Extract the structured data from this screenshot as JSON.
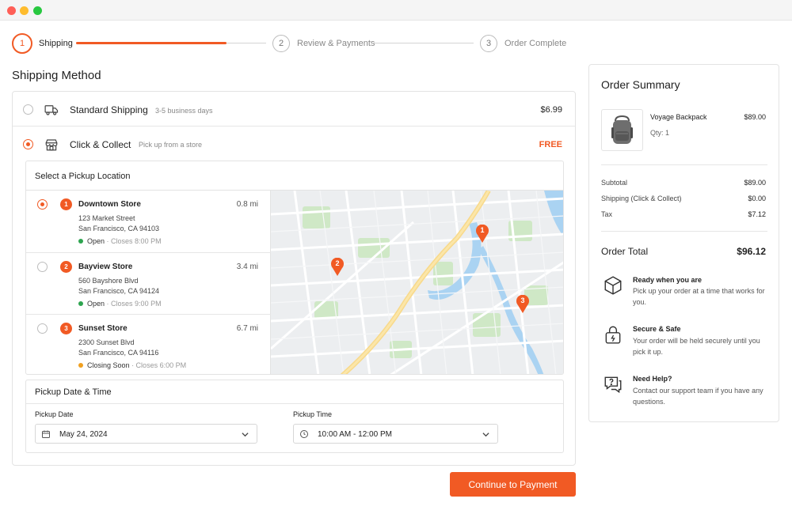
{
  "stepper": {
    "steps": [
      {
        "number": "1",
        "label": "Shipping"
      },
      {
        "number": "2",
        "label": "Review & Payments"
      },
      {
        "number": "3",
        "label": "Order Complete"
      }
    ],
    "progress": 0.5
  },
  "shipping": {
    "title": "Shipping Method",
    "options": [
      {
        "name": "Standard Shipping",
        "detail": "3-5 business days",
        "price": "$6.99",
        "selected": false
      },
      {
        "name": "Click & Collect",
        "detail": "Pick up from a store",
        "price": "FREE",
        "selected": true
      }
    ]
  },
  "pickup": {
    "title": "Select a Pickup Location",
    "stores": [
      {
        "number": "1",
        "name": "Downtown Store",
        "distance": "0.8 mi",
        "address1": "123 Market Street",
        "address2": "San Francisco, CA 94103",
        "status": "Open",
        "close": "· Closes 8:00 PM",
        "status_color": "#2ea44f",
        "selected": true
      },
      {
        "number": "2",
        "name": "Bayview Store",
        "distance": "3.4 mi",
        "address1": "560 Bayshore Blvd",
        "address2": "San Francisco, CA 94124",
        "status": "Open",
        "close": "· Closes 9:00 PM",
        "status_color": "#2ea44f",
        "selected": false
      },
      {
        "number": "3",
        "name": "Sunset Store",
        "distance": "6.7 mi",
        "address1": "2300 Sunset Blvd",
        "address2": "San Francisco, CA 94116",
        "status": "Closing Soon",
        "close": "· Closes 6:00 PM",
        "status_color": "#f0a020",
        "selected": false
      }
    ],
    "map_pins": [
      "1",
      "2",
      "3"
    ]
  },
  "datetime": {
    "title": "Pickup Date & Time",
    "date_label": "Pickup Date",
    "date_value": "May 24, 2024",
    "time_label": "Pickup Time",
    "time_value": "10:00 AM - 12:00 PM"
  },
  "continue_label": "Continue to Payment",
  "summary": {
    "title": "Order Summary",
    "item": {
      "name": "Voyage Backpack",
      "qty": "Qty: 1",
      "price": "$89.00"
    },
    "lines": [
      {
        "label": "Subtotal",
        "value": "$89.00"
      },
      {
        "label": "Shipping (Click & Collect)",
        "value": "$0.00"
      },
      {
        "label": "Tax",
        "value": "$7.12"
      }
    ],
    "total_label": "Order Total",
    "total_value": "$96.12",
    "info": [
      {
        "icon": "box-icon",
        "title": "Ready when you are",
        "text": "Pick up your order at a time that works for you."
      },
      {
        "icon": "lock-icon",
        "title": "Secure & Safe",
        "text": "Your order will be held securely until you pick it up."
      },
      {
        "icon": "chat-help-icon",
        "title": "Need Help?",
        "text": "Contact our support team if you have any questions."
      }
    ]
  },
  "colors": {
    "accent": "#f15a24",
    "open": "#2ea44f",
    "closing": "#f0a020"
  }
}
